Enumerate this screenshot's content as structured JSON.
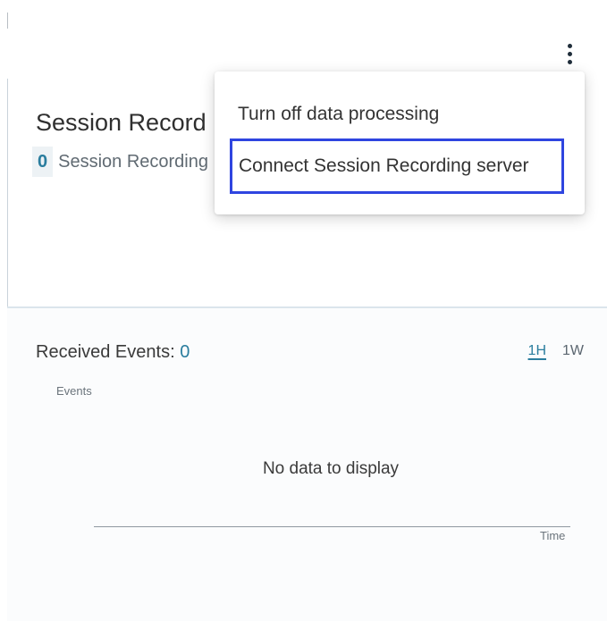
{
  "header": {
    "more_options_icon": "kebab-vertical-icon"
  },
  "card": {
    "title": "Session Record",
    "count": "0",
    "count_label": "Session Recording"
  },
  "menu": {
    "items": [
      {
        "label": "Turn off data processing"
      },
      {
        "label": "Connect Session Recording server",
        "focused": true
      }
    ],
    "focus_color": "#2f45e0"
  },
  "events": {
    "heading": "Received Events:",
    "count": "0",
    "ranges": [
      {
        "label": "1H",
        "active": true
      },
      {
        "label": "1W",
        "active": false
      }
    ],
    "y_axis_label": "Events",
    "empty_message": "No data to display",
    "x_axis_label": "Time"
  },
  "colors": {
    "accent": "#2a7d9e",
    "text": "#2d2d2d"
  }
}
